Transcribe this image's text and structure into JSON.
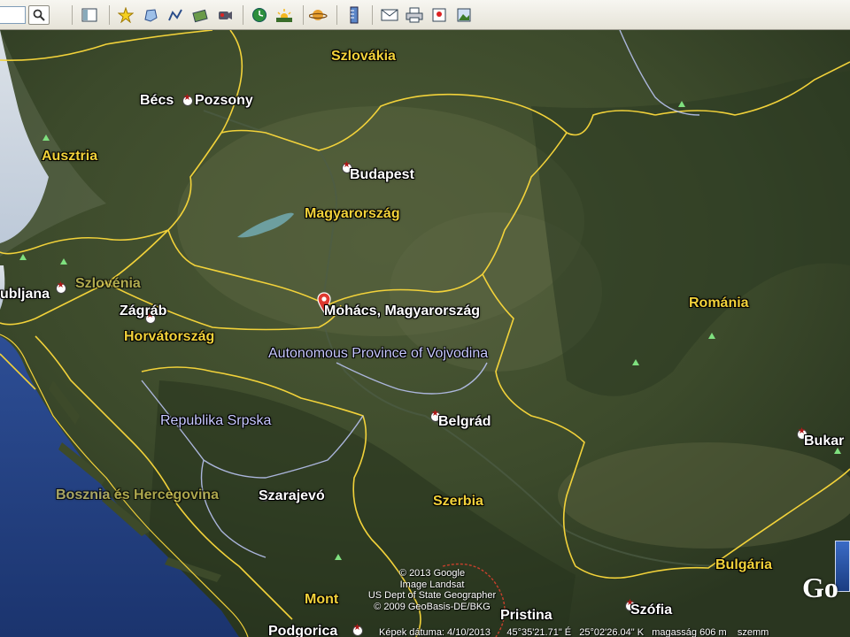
{
  "toolbar": {
    "search_placeholder": "",
    "buttons": [
      {
        "name": "search-icon",
        "glyph": "🔍"
      },
      {
        "name": "sidebar-toggle-icon",
        "glyph": "▭"
      },
      {
        "name": "add-placemark-icon",
        "glyph": "📍"
      },
      {
        "name": "add-polygon-icon",
        "glyph": "⬠"
      },
      {
        "name": "add-path-icon",
        "glyph": "〰"
      },
      {
        "name": "add-image-overlay-icon",
        "glyph": "🖼"
      },
      {
        "name": "record-tour-icon",
        "glyph": "⏺"
      },
      {
        "name": "historical-imagery-icon",
        "glyph": "🕘"
      },
      {
        "name": "sunlight-icon",
        "glyph": "☀"
      },
      {
        "name": "planets-icon",
        "glyph": "🪐"
      },
      {
        "name": "ruler-icon",
        "glyph": "📏"
      },
      {
        "name": "email-icon",
        "glyph": "✉"
      },
      {
        "name": "print-icon",
        "glyph": "🖨"
      },
      {
        "name": "view-in-maps-icon",
        "glyph": "🗺"
      },
      {
        "name": "save-image-icon",
        "glyph": "🏞"
      }
    ]
  },
  "labels": {
    "szlovakia": "Szlovákia",
    "becs": "Bécs",
    "pozsony": "Pozsony",
    "ausztria": "Ausztria",
    "budapest": "Budapest",
    "magyarorszag": "Magyarország",
    "ljubljana": "ubljana",
    "szlovenia": "Szlovénia",
    "zagrab": "Zágráb",
    "horvatorszag": "Horvátország",
    "mohacs": "Mohács, Magyarország",
    "vojvodina": "Autonomous Province of Vojvodina",
    "romania": "Románia",
    "republika_srpska": "Republika Srpska",
    "belgrad": "Belgrád",
    "bukarest": "Bukar",
    "bosznia": "Bosznia és Hercegovina",
    "szarajevo": "Szarajevó",
    "szerbia": "Szerbia",
    "bulgaria": "Bulgária",
    "montenegro": "Mont",
    "pristina": "Pristina",
    "szofia": "Szófia",
    "podgorica": "Podgorica"
  },
  "copyright": {
    "line1": "© 2013 Google",
    "line2": "Image Landsat",
    "line3": "US Dept of State Geographer",
    "line4": "© 2009 GeoBasis-DE/BKG"
  },
  "status": {
    "date": "Képek dátuma: 4/10/2013",
    "lat": "45°35'21.71\" É",
    "lon": "25°02'26.04\" K",
    "elevation": "magasság  606 m",
    "eye": "szemm"
  },
  "logo": "Go",
  "colors": {
    "border_country": "#f2d23a",
    "border_region": "#c8c9ff",
    "water": "#23407e",
    "land": "#3c4a2b"
  }
}
